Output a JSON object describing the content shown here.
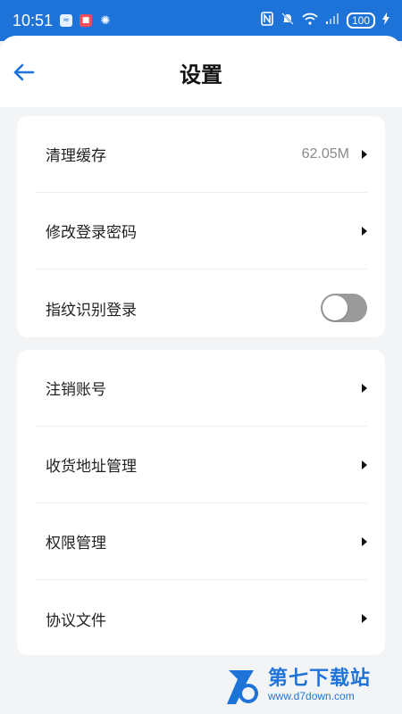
{
  "status_bar": {
    "time": "10:51",
    "battery": "100",
    "icons": [
      "app-notification-icon",
      "app-red-icon",
      "app-swirl-icon",
      "nfc-icon",
      "bell-off-icon",
      "wifi-icon",
      "signal-icon",
      "battery-icon",
      "charging-icon"
    ]
  },
  "header": {
    "title": "设置"
  },
  "section1": {
    "items": [
      {
        "label": "清理缓存",
        "value": "62.05M"
      },
      {
        "label": "修改登录密码"
      },
      {
        "label": "指纹识别登录",
        "toggle": false
      }
    ]
  },
  "section2": {
    "items": [
      {
        "label": "注销账号"
      },
      {
        "label": "收货地址管理"
      },
      {
        "label": "权限管理"
      },
      {
        "label": "协议文件"
      }
    ]
  },
  "watermark": {
    "title": "第七下载站",
    "url": "www.d7down.com"
  },
  "colors": {
    "accent": "#1e73d8",
    "background": "#f3f4f6",
    "toggle_off": "#9a9a9a"
  }
}
